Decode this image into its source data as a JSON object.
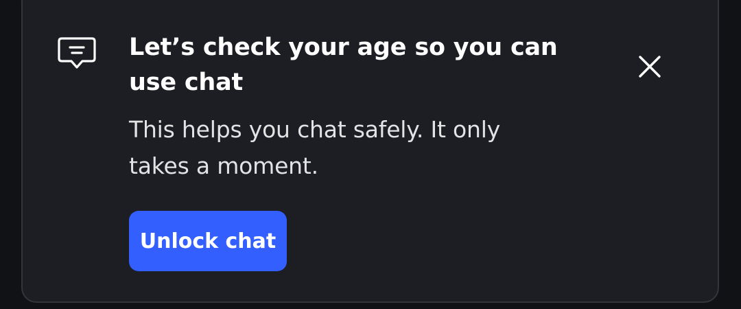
{
  "banner": {
    "icon": "chat-bubble-icon",
    "title": "Let’s check your age so you can use chat",
    "message": "This helps you chat safely. It only takes a moment.",
    "close_icon": "close-icon",
    "cta_label": "Unlock chat"
  },
  "colors": {
    "background": "#111216",
    "card": "#1d1e23",
    "card_border": "#34353b",
    "accent": "#335fff",
    "text_primary": "#ffffff",
    "text_secondary": "#e3e3e6"
  }
}
